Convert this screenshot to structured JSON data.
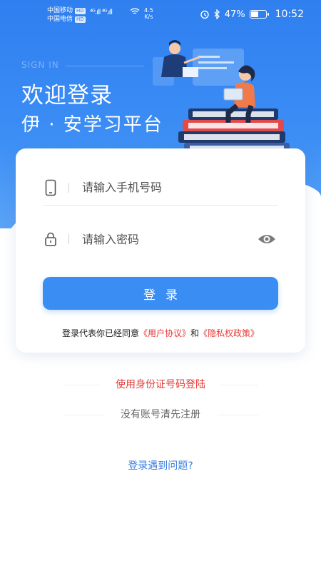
{
  "status_bar": {
    "carrier1": "中国移动",
    "carrier2": "中国电信",
    "hd": "HD",
    "signal": "⁴ᴳ.ıll ⁴ᴳ.ıll",
    "net_speed": "4.5",
    "net_unit": "K/s",
    "battery": "47%",
    "time": "10:52"
  },
  "header": {
    "watermark": "SIGN IN",
    "welcome": "欢迎登录",
    "platform": "伊 · 安学习平台"
  },
  "form": {
    "phone_placeholder": "请输入手机号码",
    "password_placeholder": "请输入密码",
    "login_label": "登录",
    "agreement_prefix": "登录代表你已经同意",
    "user_agreement": "《用户协议》",
    "agreement_and": "和",
    "privacy_policy": "《隐私权政策》"
  },
  "links": {
    "id_login": "使用身份证号码登陆",
    "register": "没有账号清先注册",
    "help": "登录遇到问题?"
  },
  "colors": {
    "primary": "#3a8df3",
    "link_red": "#e53935",
    "help_blue": "#3a7ee0"
  }
}
